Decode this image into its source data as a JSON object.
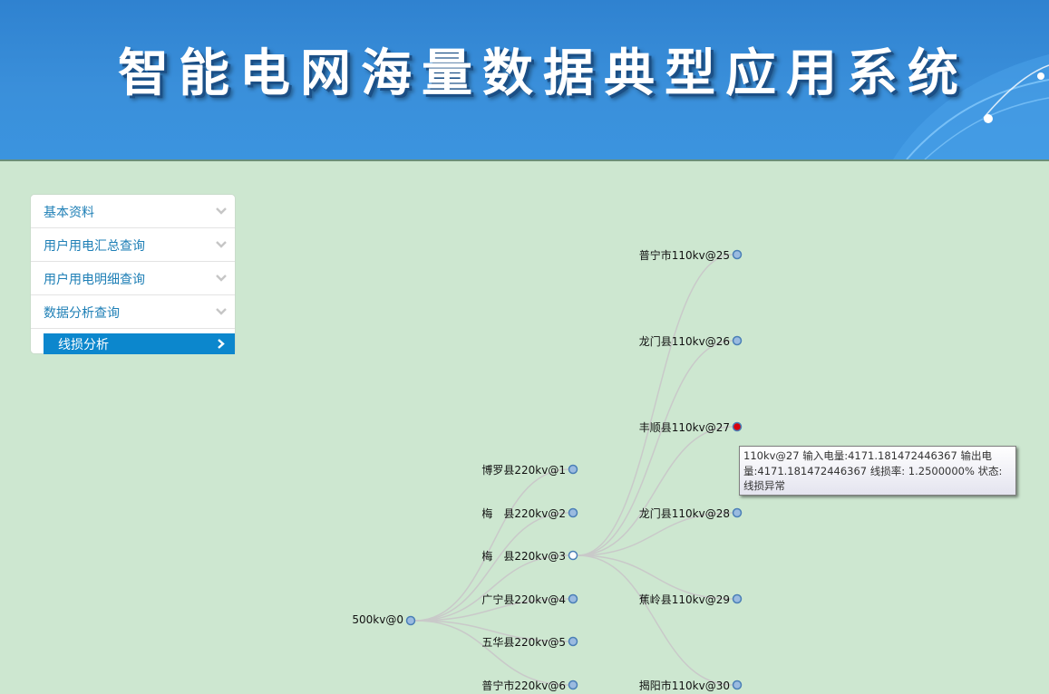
{
  "header": {
    "title": "智能电网海量数据典型应用系统"
  },
  "menu": {
    "items": [
      {
        "label": "基本资料",
        "icon": "chevron-down-icon"
      },
      {
        "label": "用户用电汇总查询",
        "icon": "chevron-down-icon"
      },
      {
        "label": "用户用电明细查询",
        "icon": "chevron-down-icon"
      },
      {
        "label": "数据分析查询",
        "icon": "chevron-down-icon"
      }
    ],
    "active_sub": {
      "label": "线损分析",
      "icon": "chevron-right-icon"
    }
  },
  "tree": {
    "root": {
      "label": "500kv@0",
      "status": "normal"
    },
    "level1": [
      {
        "label": "博罗县220kv@1",
        "status": "normal"
      },
      {
        "label": "梅　县220kv@2",
        "status": "normal"
      },
      {
        "label": "梅　县220kv@3",
        "status": "expanded"
      },
      {
        "label": "广宁县220kv@4",
        "status": "normal"
      },
      {
        "label": "五华县220kv@5",
        "status": "normal"
      },
      {
        "label": "普宁市220kv@6",
        "status": "normal"
      }
    ],
    "level2": [
      {
        "label": "普宁市110kv@25",
        "status": "normal"
      },
      {
        "label": "龙门县110kv@26",
        "status": "normal"
      },
      {
        "label": "丰顺县110kv@27",
        "status": "abnormal"
      },
      {
        "label": "龙门县110kv@28",
        "status": "normal"
      },
      {
        "label": "蕉岭县110kv@29",
        "status": "normal"
      },
      {
        "label": "揭阳市110kv@30",
        "status": "normal"
      }
    ]
  },
  "tooltip": {
    "text": "110kv@27 输入电量:4171.181472446367 输出电量:4171.181472446367 线损率: 1.2500000%  状态:线损异常"
  },
  "colors": {
    "header_blue": "#3a8fda",
    "background": "#cde7d0",
    "menu_active": "#0c87cd",
    "node_normal": "#9bbbe0",
    "node_expanded": "#ffffff",
    "node_abnormal": "#d8000c",
    "link": "#c9c9c9"
  }
}
